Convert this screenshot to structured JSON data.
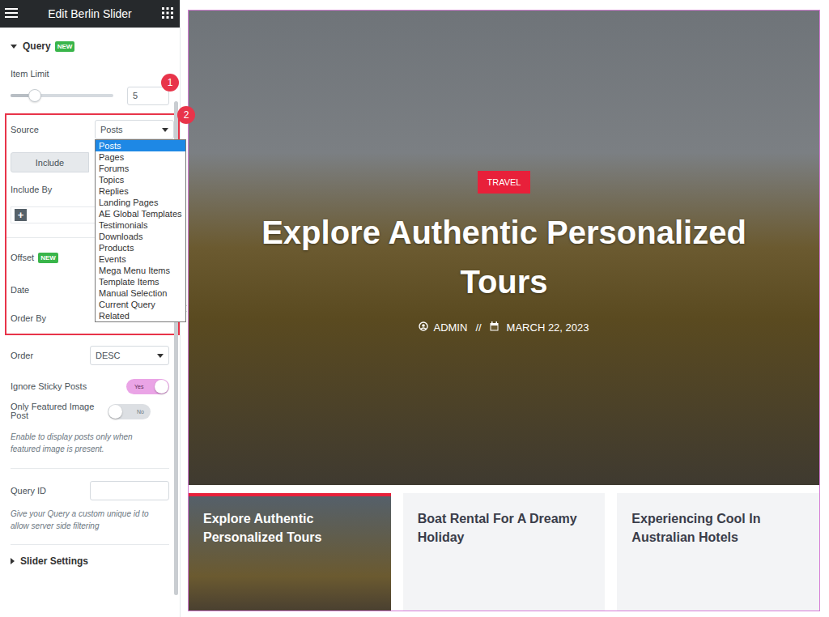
{
  "header": {
    "title": "Edit Berlin Slider"
  },
  "query": {
    "title": "Query",
    "badge": "NEW",
    "expanded": true
  },
  "item_limit": {
    "label": "Item Limit",
    "value": "5",
    "level": 0.24
  },
  "source": {
    "label": "Source",
    "value": "Posts",
    "open": true,
    "options": [
      {
        "label": "Posts",
        "selected": true
      },
      {
        "label": "Pages",
        "selected": false
      },
      {
        "label": "Forums",
        "selected": false
      },
      {
        "label": "Topics",
        "selected": false
      },
      {
        "label": "Replies",
        "selected": false
      },
      {
        "label": "Landing Pages",
        "selected": false
      },
      {
        "label": "AE Global Templates",
        "selected": false
      },
      {
        "label": "Testimonials",
        "selected": false
      },
      {
        "label": "Downloads",
        "selected": false
      },
      {
        "label": "Products",
        "selected": false
      },
      {
        "label": "Events",
        "selected": false
      },
      {
        "label": "Mega Menu Items",
        "selected": false
      },
      {
        "label": "Template Items",
        "selected": false
      },
      {
        "label": "Manual Selection",
        "selected": false
      },
      {
        "label": "Current Query",
        "selected": false
      },
      {
        "label": "Related",
        "selected": false
      }
    ]
  },
  "include_tabs": [
    {
      "label": "Include",
      "selected": true
    }
  ],
  "include_by": {
    "label": "Include By",
    "add": "+"
  },
  "offset": {
    "label": "Offset",
    "badge": "NEW"
  },
  "date": {
    "label": "Date"
  },
  "order_by": {
    "label": "Order By"
  },
  "order": {
    "label": "Order",
    "value": "DESC"
  },
  "ignore_sticky": {
    "label": "Ignore Sticky Posts",
    "on": true,
    "state_text": "Yes"
  },
  "only_featured": {
    "label": "Only Featured Image Post",
    "on": false,
    "state_text": "No",
    "help": "Enable to display posts only when featured image is present."
  },
  "query_id": {
    "label": "Query ID",
    "value": "",
    "help": "Give your Query a custom unique id to allow server side filtering"
  },
  "slider_settings": {
    "label": "Slider Settings",
    "expanded": false
  },
  "annotations": [
    "1",
    "2"
  ],
  "slide": {
    "category": "TRAVEL",
    "title": "Explore Authentic Personalized Tours",
    "author": "ADMIN",
    "separator": "//",
    "date": "MARCH 22, 2023"
  },
  "thumbs": [
    {
      "title": "Explore Authentic Personalized Tours",
      "selected": true
    },
    {
      "title": "Boat Rental For A Dreamy Holiday",
      "selected": false
    },
    {
      "title": "Experiencing Cool In Australian Hotels",
      "selected": false
    }
  ]
}
